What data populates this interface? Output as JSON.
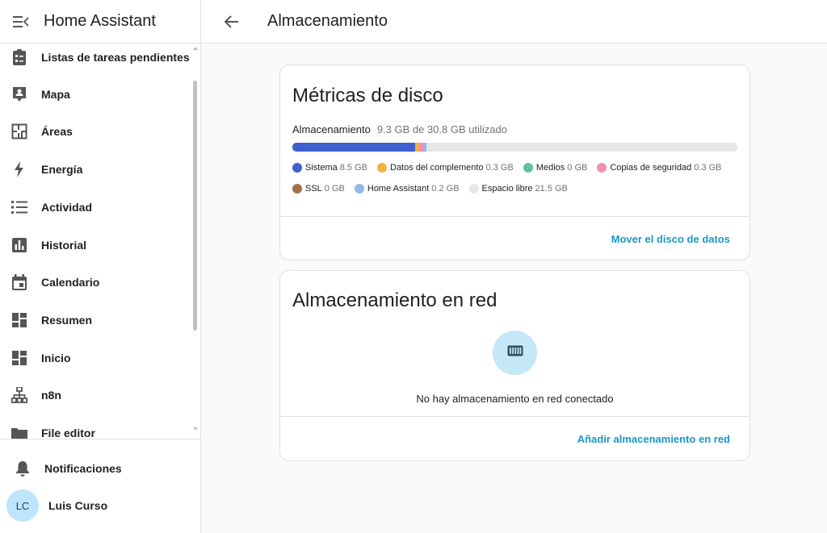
{
  "sidebar": {
    "title": "Home Assistant",
    "items": [
      {
        "label": "Listas de tareas pendientes",
        "icon": "clipboard-list-icon"
      },
      {
        "label": "Mapa",
        "icon": "map-account-icon"
      },
      {
        "label": "Áreas",
        "icon": "floor-plan-icon"
      },
      {
        "label": "Energía",
        "icon": "lightning-bolt-icon"
      },
      {
        "label": "Actividad",
        "icon": "format-list-bulleted-icon"
      },
      {
        "label": "Historial",
        "icon": "chart-box-icon"
      },
      {
        "label": "Calendario",
        "icon": "calendar-icon"
      },
      {
        "label": "Resumen",
        "icon": "view-dashboard-icon"
      },
      {
        "label": "Inicio",
        "icon": "view-dashboard-icon"
      },
      {
        "label": "n8n",
        "icon": "sitemap-icon"
      },
      {
        "label": "File editor",
        "icon": "folder-icon"
      }
    ],
    "notifications_label": "Notificaciones",
    "user": {
      "initials": "LC",
      "name": "Luis Curso"
    }
  },
  "topbar": {
    "title": "Almacenamiento"
  },
  "disk_card": {
    "title": "Métricas de disco",
    "storage_label": "Almacenamiento",
    "storage_usage": "9.3 GB de 30.8 GB utilizado",
    "usage_fraction": 0.302,
    "segments": [
      {
        "name": "Sistema",
        "value": "8.5 GB",
        "gb": 8.5,
        "color": "#4060d0"
      },
      {
        "name": "Datos del complemento",
        "value": "0.3 GB",
        "gb": 0.3,
        "color": "#f5b042"
      },
      {
        "name": "Medios",
        "value": "0 GB",
        "gb": 0,
        "color": "#5dc2a5"
      },
      {
        "name": "Copias de seguridad",
        "value": "0.3 GB",
        "gb": 0.3,
        "color": "#f48fb1"
      },
      {
        "name": "SSL",
        "value": "0 GB",
        "gb": 0,
        "color": "#a0704a"
      },
      {
        "name": "Home Assistant",
        "value": "0.2 GB",
        "gb": 0.2,
        "color": "#90b8ea"
      },
      {
        "name": "Espacio libre",
        "value": "21.5 GB",
        "gb": 21.5,
        "color": "#e6e6e6"
      }
    ],
    "total_gb": 30.8,
    "action": "Mover el disco de datos"
  },
  "network_card": {
    "title": "Almacenamiento en red",
    "empty_text": "No hay almacenamiento en red conectado",
    "action": "Añadir almacenamiento en red",
    "icon": "nas-icon"
  },
  "colors": {
    "accent": "#1b98c7",
    "avatar_bg": "#bde5fb"
  }
}
